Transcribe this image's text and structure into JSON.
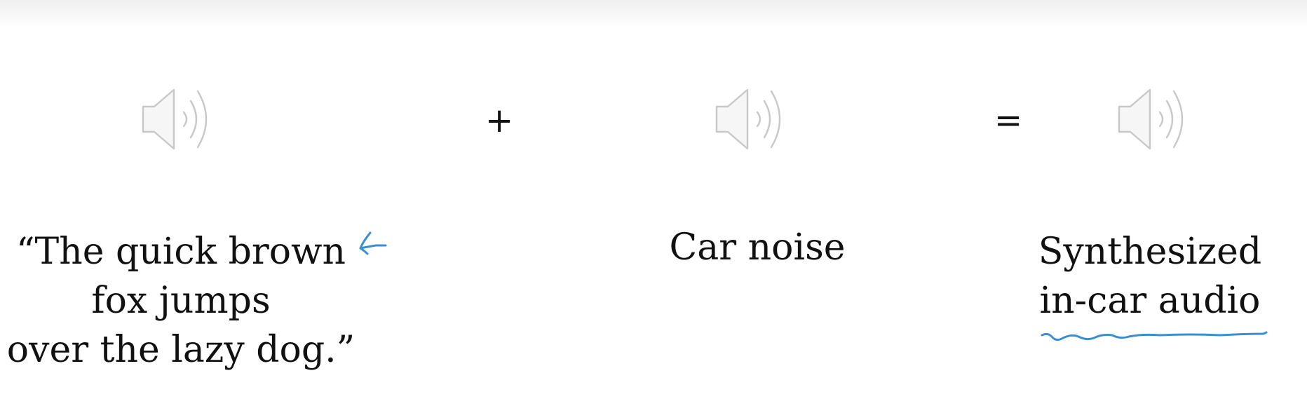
{
  "equation": {
    "speech": {
      "icon": "speaker-icon",
      "lines": [
        "“The quick brown",
        "fox jumps",
        "over the lazy dog.”"
      ]
    },
    "plus": "+",
    "noise": {
      "icon": "speaker-icon",
      "label": "Car noise"
    },
    "equals": "=",
    "result": {
      "icon": "speaker-icon",
      "lines": [
        "Synthesized",
        "in-car audio"
      ]
    }
  },
  "annotations": {
    "color": "#3a8fd0",
    "arrow": "arrow-annotation",
    "underline": "underline-annotation"
  }
}
